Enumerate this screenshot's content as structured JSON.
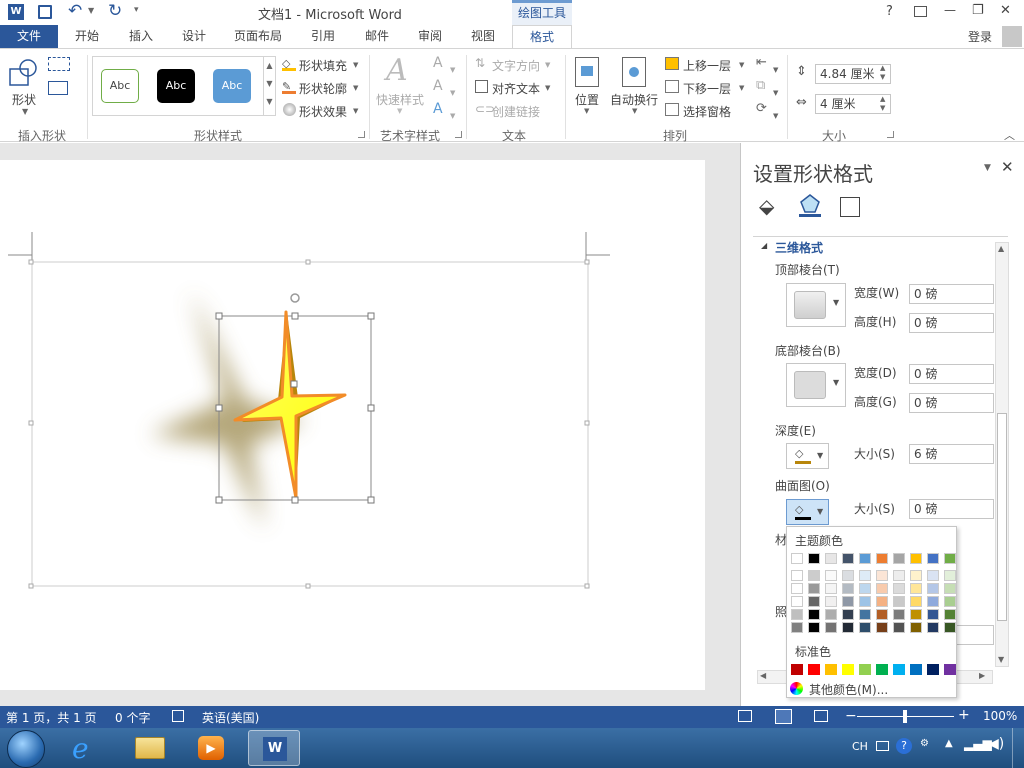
{
  "title_bar": {
    "title": "文档1 - Microsoft Word",
    "context_tool": "绘图工具",
    "help": "?",
    "minimize": "—",
    "restore": "❐",
    "close": "✕"
  },
  "tabs": {
    "file": "文件",
    "items": [
      "开始",
      "插入",
      "设计",
      "页面布局",
      "引用",
      "邮件",
      "审阅",
      "视图"
    ],
    "active": "格式",
    "login": "登录"
  },
  "ribbon": {
    "insert_shape": {
      "shape_label": "形状",
      "group_label": "插入形状"
    },
    "shape_styles": {
      "presets": [
        "Abc",
        "Abc",
        "Abc"
      ],
      "fill": "形状填充",
      "outline": "形状轮廓",
      "effect": "形状效果",
      "group_label": "形状样式"
    },
    "wordart": {
      "quick_styles": "快速样式",
      "group_label": "艺术字样式"
    },
    "text": {
      "direction": "文字方向",
      "align": "对齐文本",
      "link": "创建链接",
      "group_label": "文本"
    },
    "arrange": {
      "position": "位置",
      "wrap": "自动换行",
      "bring_forward": "上移一层",
      "send_backward": "下移一层",
      "selection_pane": "选择窗格",
      "group_label": "排列"
    },
    "size": {
      "height": "4.84 厘米",
      "width": "4 厘米",
      "group_label": "大小"
    }
  },
  "panel": {
    "title": "设置形状格式",
    "section": "三维格式",
    "top_bevel": "顶部棱台(T)",
    "top_width_label": "宽度(W)",
    "top_width": "0 磅",
    "top_height_label": "高度(H)",
    "top_height": "0 磅",
    "bottom_bevel": "底部棱台(B)",
    "bottom_width_label": "宽度(D)",
    "bottom_width": "0 磅",
    "bottom_height_label": "高度(G)",
    "bottom_height": "0 磅",
    "depth": "深度(E)",
    "depth_size_label": "大小(S)",
    "depth_size": "6 磅",
    "contour": "曲面图(O)",
    "contour_size_label": "大小(S)",
    "contour_size": "0 磅",
    "material_partial": "材",
    "lighting_partial": "照"
  },
  "color_picker": {
    "theme_label": "主题颜色",
    "standard_label": "标准色",
    "more_colors": "其他颜色(M)...",
    "theme_colors": [
      "#ffffff",
      "#000000",
      "#e7e6e6",
      "#44546a",
      "#5b9bd5",
      "#ed7d31",
      "#a5a5a5",
      "#ffc000",
      "#4472c4",
      "#70ad47"
    ],
    "standard_colors": [
      "#c00000",
      "#ff0000",
      "#ffc000",
      "#ffff00",
      "#92d050",
      "#00b050",
      "#00b0f0",
      "#0070c0",
      "#002060",
      "#7030a0"
    ]
  },
  "status": {
    "page": "第 1 页，共 1 页",
    "words": "0 个字",
    "language": "英语(美国)",
    "zoom": "100%"
  },
  "taskbar": {
    "lang": "CH"
  }
}
